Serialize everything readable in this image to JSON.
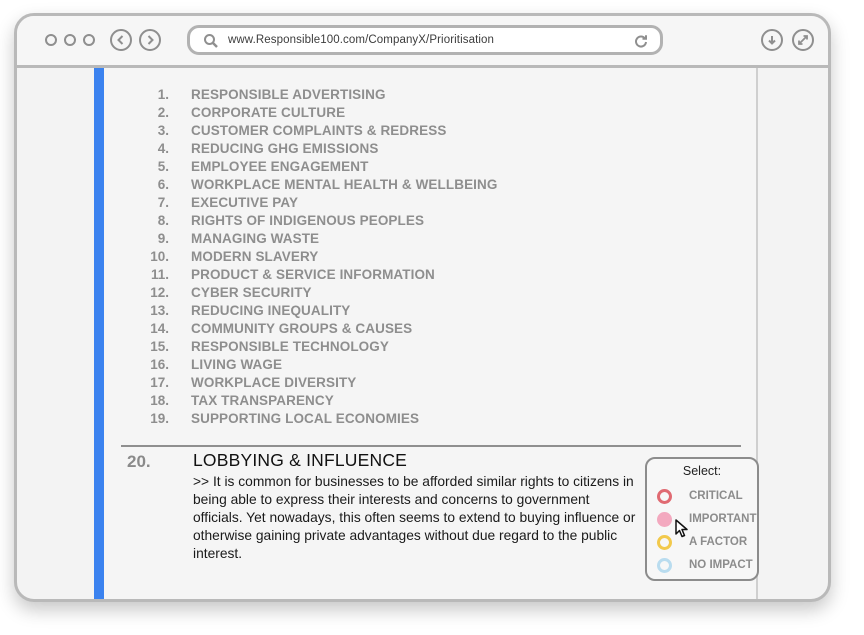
{
  "browser": {
    "url": "www.Responsible100.com/CompanyX/Prioritisation"
  },
  "list": [
    {
      "num": "1.",
      "label": "RESPONSIBLE ADVERTISING"
    },
    {
      "num": "2.",
      "label": "CORPORATE CULTURE"
    },
    {
      "num": "3.",
      "label": "CUSTOMER COMPLAINTS & REDRESS"
    },
    {
      "num": "4.",
      "label": "REDUCING GHG EMISSIONS"
    },
    {
      "num": "5.",
      "label": "EMPLOYEE ENGAGEMENT"
    },
    {
      "num": "6.",
      "label": "WORKPLACE MENTAL HEALTH & WELLBEING"
    },
    {
      "num": "7.",
      "label": "EXECUTIVE PAY"
    },
    {
      "num": "8.",
      "label": "RIGHTS OF INDIGENOUS PEOPLES"
    },
    {
      "num": "9.",
      "label": "MANAGING WASTE"
    },
    {
      "num": "10.",
      "label": "MODERN SLAVERY"
    },
    {
      "num": "11.",
      "label": "PRODUCT & SERVICE INFORMATION"
    },
    {
      "num": "12.",
      "label": "CYBER SECURITY"
    },
    {
      "num": "13.",
      "label": "REDUCING INEQUALITY"
    },
    {
      "num": "14.",
      "label": "COMMUNITY GROUPS & CAUSES"
    },
    {
      "num": "15.",
      "label": "RESPONSIBLE TECHNOLOGY"
    },
    {
      "num": "16.",
      "label": "LIVING WAGE"
    },
    {
      "num": "17.",
      "label": "WORKPLACE DIVERSITY"
    },
    {
      "num": "18.",
      "label": "TAX TRANSPARENCY"
    },
    {
      "num": "19.",
      "label": "SUPPORTING LOCAL ECONOMIES"
    }
  ],
  "current_item": {
    "num": "20.",
    "title": "LOBBYING & INFLUENCE",
    "description": ">> It is common for businesses to be afforded similar rights to citizens in being able to express their interests and concerns to government officials. Yet nowadays, this often seems to extend to buying influence or otherwise gaining private advantages without due regard to the public interest."
  },
  "selector": {
    "title": "Select:",
    "options": [
      {
        "label": "CRITICAL",
        "color": "#e06a72",
        "filled": false
      },
      {
        "label": "IMPORTANT",
        "color": "#f3a9bf",
        "filled": true
      },
      {
        "label": "A FACTOR",
        "color": "#f2c94c",
        "filled": false
      },
      {
        "label": "NO IMPACT",
        "color": "#b9dcef",
        "filled": false
      }
    ]
  },
  "colors": {
    "accent": "#3b82ef"
  }
}
